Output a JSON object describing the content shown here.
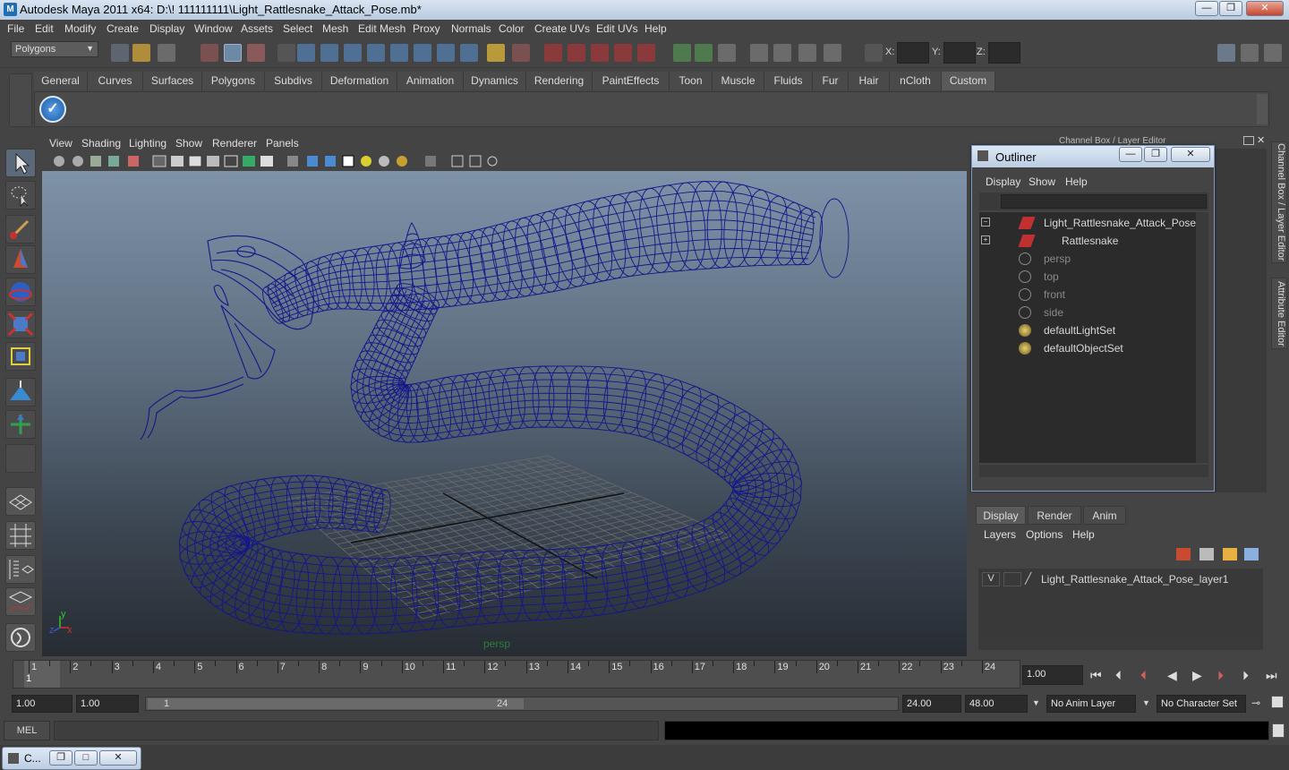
{
  "window": {
    "title": "Autodesk Maya 2011 x64: D:\\! 111111111\\Light_Rattlesnake_Attack_Pose.mb*",
    "min": "—",
    "max": "❐",
    "close": "✕"
  },
  "menubar": [
    "File",
    "Edit",
    "Modify",
    "Create",
    "Display",
    "Window",
    "Assets",
    "Select",
    "Mesh",
    "Edit Mesh",
    "Proxy",
    "Normals",
    "Color",
    "Create UVs",
    "Edit UVs",
    "Help"
  ],
  "statusline": {
    "mode": "Polygons",
    "x_label": "X:",
    "y_label": "Y:",
    "z_label": "Z:"
  },
  "shelf": {
    "tabs": [
      "General",
      "Curves",
      "Surfaces",
      "Polygons",
      "Subdivs",
      "Deformation",
      "Animation",
      "Dynamics",
      "Rendering",
      "PaintEffects",
      "Toon",
      "Muscle",
      "Fluids",
      "Fur",
      "Hair",
      "nCloth",
      "Custom"
    ],
    "active": "Custom"
  },
  "viewport": {
    "menu": [
      "View",
      "Shading",
      "Lighting",
      "Show",
      "Renderer",
      "Panels"
    ],
    "camera": "persp",
    "axis_y": "y",
    "axis_x": "x",
    "axis_z": "z"
  },
  "channelbox_title": "Channel Box / Layer Editor",
  "sidetabs": [
    "Channel Box / Layer Editor",
    "Attribute Editor"
  ],
  "outliner": {
    "title": "Outliner",
    "menu": [
      "Display",
      "Show",
      "Help"
    ],
    "items": [
      {
        "label": "Light_Rattlesnake_Attack_Pose",
        "dim": false
      },
      {
        "label": "Rattlesnake",
        "dim": false
      },
      {
        "label": "persp",
        "dim": true
      },
      {
        "label": "top",
        "dim": true
      },
      {
        "label": "front",
        "dim": true
      },
      {
        "label": "side",
        "dim": true
      },
      {
        "label": "defaultLightSet",
        "dim": false
      },
      {
        "label": "defaultObjectSet",
        "dim": false
      }
    ]
  },
  "layer_editor": {
    "tabs": [
      "Display",
      "Render",
      "Anim"
    ],
    "active": "Display",
    "menu": [
      "Layers",
      "Options",
      "Help"
    ],
    "layer": {
      "visible": "V",
      "name": "Light_Rattlesnake_Attack_Pose_layer1"
    }
  },
  "timeline": {
    "ticks": [
      1,
      2,
      3,
      4,
      5,
      6,
      7,
      8,
      9,
      10,
      11,
      12,
      13,
      14,
      15,
      16,
      17,
      18,
      19,
      20,
      21,
      22,
      23,
      24
    ],
    "current_frame": "1",
    "current_time_field": "1.00"
  },
  "range": {
    "start": "1.00",
    "playback_start": "1.00",
    "slider_min": "1",
    "slider_max": "24",
    "playback_end": "24.00",
    "end": "48.00",
    "anim_layer": "No Anim Layer",
    "character_set": "No Character Set"
  },
  "cmdline": {
    "label": "MEL"
  },
  "taskbar": {
    "label": "C..."
  },
  "colors": {
    "wireframe": "#14168a",
    "grid": "#6a6a6a",
    "accent": "#7a9ccc"
  }
}
